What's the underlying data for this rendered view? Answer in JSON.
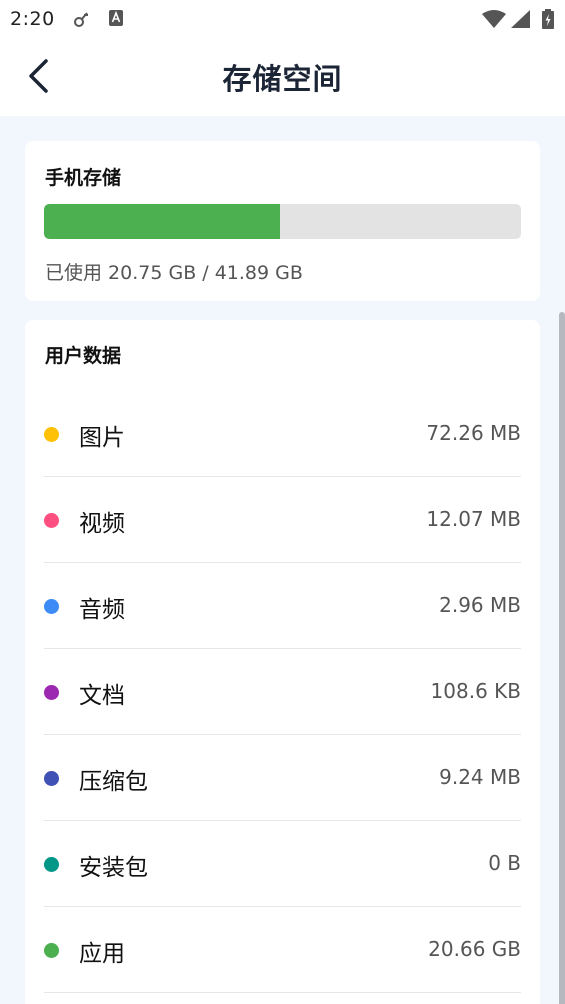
{
  "status_bar": {
    "time": "2:20"
  },
  "header": {
    "title": "存储空间"
  },
  "storage": {
    "title": "手机存储",
    "used_fraction": 0.4953,
    "usage_text": "已使用 20.75 GB / 41.89 GB"
  },
  "user_data": {
    "title": "用户数据",
    "items": [
      {
        "label": "图片",
        "size": "72.26 MB",
        "color": "#ffc107"
      },
      {
        "label": "视频",
        "size": "12.07 MB",
        "color": "#ff4f81"
      },
      {
        "label": "音频",
        "size": "2.96 MB",
        "color": "#3d8bf7"
      },
      {
        "label": "文档",
        "size": "108.6 KB",
        "color": "#9c27b0"
      },
      {
        "label": "压缩包",
        "size": "9.24 MB",
        "color": "#3f51b5"
      },
      {
        "label": "安装包",
        "size": "0 B",
        "color": "#009688"
      },
      {
        "label": "应用",
        "size": "20.66 GB",
        "color": "#4caf50"
      }
    ]
  },
  "colors": {
    "accent_green": "#4caf50",
    "background": "#f2f6fd"
  }
}
